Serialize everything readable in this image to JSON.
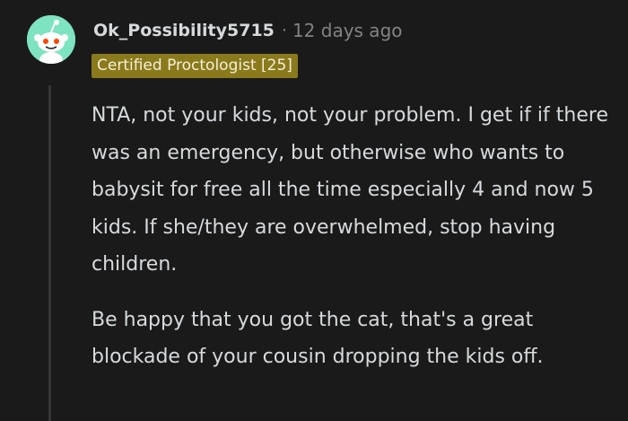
{
  "comment": {
    "username": "Ok_Possibility5715",
    "separator": "·",
    "timestamp": "12 days ago",
    "flair": "Certified Proctologist [25]",
    "paragraphs": [
      "NTA, not your kids, not your problem. I get if if there was an emergency, but otherwise who wants to babysit for free all the time especially 4 and now 5 kids. If she/they are overwhelmed, stop having children.",
      "Be happy that you got the cat, that's a great blockade of your cousin dropping the kids off."
    ]
  },
  "colors": {
    "background": "#1a1a1b",
    "text": "#d7dadc",
    "meta": "#818384",
    "flair_bg": "#8a7a1c",
    "avatar_bg": "#7ee3c0"
  },
  "icons": {
    "avatar": "snoo-avatar-icon"
  }
}
